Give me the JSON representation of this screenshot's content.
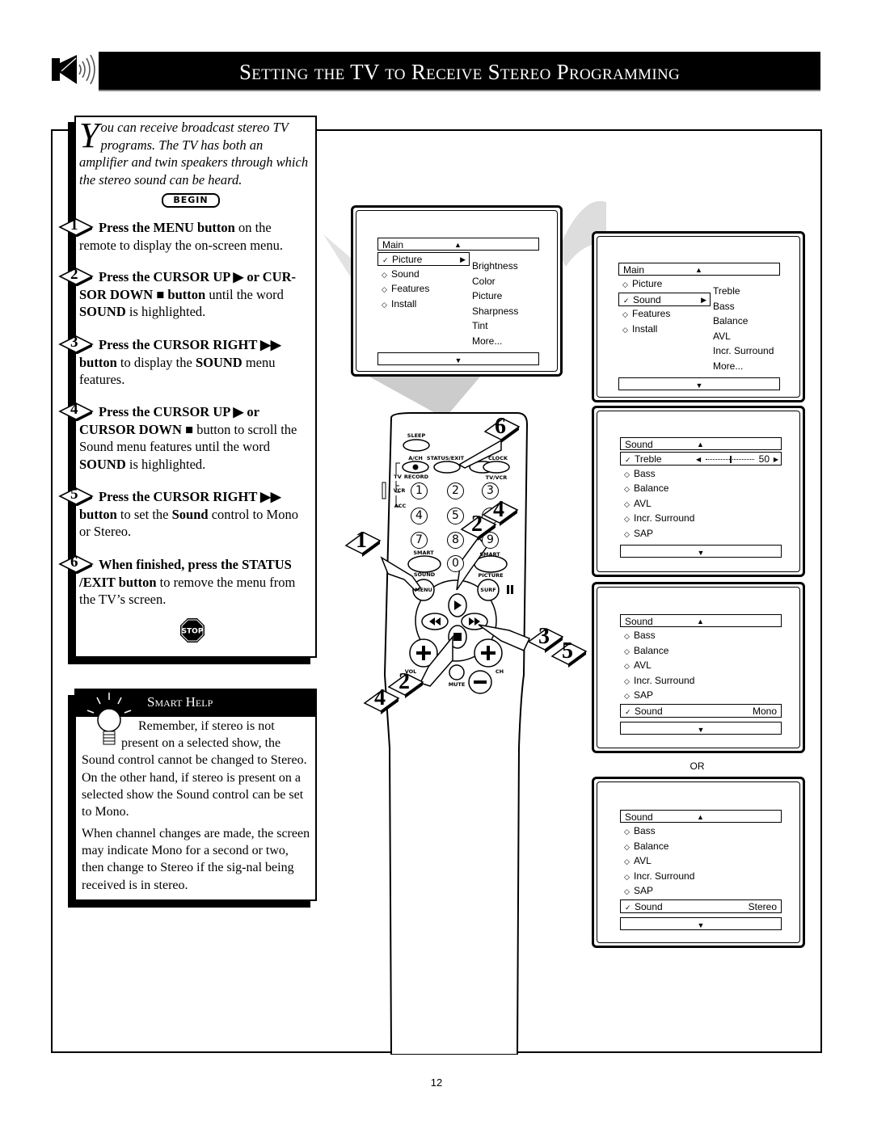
{
  "header": {
    "title": "Setting the TV to Receive Stereo Programming",
    "icon": "speaker-icon"
  },
  "intro": {
    "dropcap": "Y",
    "text": "ou can receive broadcast stereo TV programs.  The TV has both an amplifier and twin speakers through which the stereo sound can be heard."
  },
  "begin_label": "BEGIN",
  "steps": [
    {
      "num": "1",
      "parts": [
        {
          "t": "Press the MENU button",
          "b": true
        },
        {
          "t": " on the remote to display the on-screen menu."
        }
      ]
    },
    {
      "num": "2",
      "parts": [
        {
          "t": "Press the CURSOR UP ▶ or CUR-SOR DOWN ■ button",
          "b": true
        },
        {
          "t": " until the word "
        },
        {
          "t": "SOUND",
          "b": true
        },
        {
          "t": " is highlighted."
        }
      ]
    },
    {
      "num": "3",
      "parts": [
        {
          "t": "Press the CURSOR RIGHT ▶▶ button",
          "b": true
        },
        {
          "t": " to display the "
        },
        {
          "t": "SOUND",
          "b": true
        },
        {
          "t": " menu features."
        }
      ]
    },
    {
      "num": "4",
      "parts": [
        {
          "t": "Press the CURSOR UP ▶ or CURSOR DOWN ■",
          "b": true
        },
        {
          "t": " button to scroll the Sound menu features until the word "
        },
        {
          "t": "SOUND",
          "b": true
        },
        {
          "t": " is highlighted."
        }
      ]
    },
    {
      "num": "5",
      "parts": [
        {
          "t": "Press the CURSOR RIGHT ▶▶ button",
          "b": true
        },
        {
          "t": " to set the "
        },
        {
          "t": "Sound",
          "b": true
        },
        {
          "t": " control to Mono or Stereo."
        }
      ]
    },
    {
      "num": "6",
      "parts": [
        {
          "t": "When finished, press the STATUS /EXIT button",
          "b": true
        },
        {
          "t": " to remove the menu from the TV’s screen."
        }
      ]
    }
  ],
  "stop_label": "STOP",
  "smart_help": {
    "title": "Smart Help",
    "p1": "Remember, if stereo is not present on a selected show, the Sound control cannot be changed to Stereo. On the other hand, if stereo is present on a selected show the Sound control can be set to Mono.",
    "p2": "When channel changes are made, the screen may indicate Mono for a second or two, then change to Stereo if the sig-nal being received is in stereo."
  },
  "tv_menu": {
    "header": "Main",
    "left": [
      {
        "label": "Picture",
        "selected": true
      },
      {
        "label": "Sound"
      },
      {
        "label": "Features"
      },
      {
        "label": "Install"
      }
    ],
    "right": [
      "Brightness",
      "Color",
      "Picture",
      "Sharpness",
      "Tint",
      "More..."
    ]
  },
  "menus": [
    {
      "header": "Main",
      "left": [
        {
          "label": "Picture"
        },
        {
          "label": "Sound",
          "selected": true
        },
        {
          "label": "Features"
        },
        {
          "label": "Install"
        }
      ],
      "right": [
        "Treble",
        "Bass",
        "Balance",
        "AVL",
        "Incr. Surround",
        "More..."
      ]
    },
    {
      "header": "Sound",
      "rows": [
        {
          "label": "Treble",
          "selected": true,
          "slider": 50,
          "value": "50"
        },
        {
          "label": "Bass"
        },
        {
          "label": "Balance"
        },
        {
          "label": "AVL"
        },
        {
          "label": "Incr. Surround"
        },
        {
          "label": "SAP"
        }
      ]
    },
    {
      "header": "Sound",
      "rows": [
        {
          "label": "Bass"
        },
        {
          "label": "Balance"
        },
        {
          "label": "AVL"
        },
        {
          "label": "Incr. Surround"
        },
        {
          "label": "SAP"
        },
        {
          "label": "Sound",
          "selected": true,
          "value": "Mono"
        }
      ]
    },
    {
      "header": "Sound",
      "rows": [
        {
          "label": "Bass"
        },
        {
          "label": "Balance"
        },
        {
          "label": "AVL"
        },
        {
          "label": "Incr. Surround"
        },
        {
          "label": "SAP"
        },
        {
          "label": "Sound",
          "selected": true,
          "value": "Stereo"
        }
      ]
    }
  ],
  "or_label": "OR",
  "remote": {
    "labels": {
      "sleep": "SLEEP",
      "ach": "A/CH",
      "status": "STATUS/EXIT",
      "clock": "CLOCK",
      "record": "RECORD",
      "tvvcr": "TV/VCR",
      "tv": "TV",
      "vcr": "VCR",
      "acc": "ACC",
      "smart1": "SMART",
      "sound": "SOUND",
      "smart2": "SMART",
      "picture": "PICTURE",
      "menu": "MENU",
      "surf": "SURF",
      "vol": "VOL",
      "ch": "CH",
      "mute": "MUTE"
    },
    "digits": [
      "1",
      "2",
      "3",
      "4",
      "5",
      "6",
      "7",
      "8",
      "9",
      "0"
    ],
    "callouts": [
      "6",
      "4",
      "2",
      "1",
      "3",
      "5",
      "2",
      "4"
    ]
  },
  "page_number": "12"
}
